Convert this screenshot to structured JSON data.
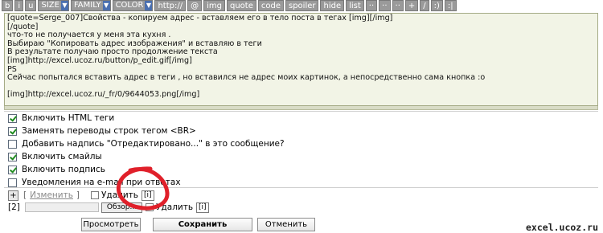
{
  "toolbar": {
    "buttons": [
      "b",
      "i",
      "u",
      "SIZE",
      "FAMILY",
      "COLOR",
      "http://",
      "@",
      "img",
      "quote",
      "code",
      "spoiler",
      "hide",
      "list",
      "··",
      "··",
      "··",
      "+",
      "/",
      ":)",
      ":|"
    ]
  },
  "editor": {
    "lines": [
      "[quote=Serge_007]Свойства - копируем адрес - вставляем его в тело поста в тегах [img][/img]",
      "[/quote]",
      "что-то не получается у меня эта кухня .",
      "Выбираю \"Копировать адрес изображения\" и вставляю в теги",
      "В результате получаю просто продолжение текста",
      "[img]http://excel.ucoz.ru/button/p_edit.gif[/img]",
      "PS",
      "Сейчас попытался вставить адрес в теги , но вставился не адрес моих картинок, а непосредственно сама кнопка :o",
      "",
      "[img]http://excel.ucoz.ru/_fr/0/9644053.png[/img]"
    ]
  },
  "options": [
    {
      "label": "Включить HTML теги",
      "checked": true
    },
    {
      "label": "Заменять переводы строк тегом <BR>",
      "checked": true
    },
    {
      "label": "Добавить надпись \"Отредактировано...\" в это сообщение?",
      "checked": false
    },
    {
      "label": "Включить смайлы",
      "checked": true
    },
    {
      "label": "Включить подпись",
      "checked": true
    },
    {
      "label": "Уведомления на e-mail при ответах",
      "checked": false
    }
  ],
  "attachments": {
    "row1": {
      "add": "+",
      "bracket_open": "[",
      "edit_label": "Изменить",
      "bracket_close": "]",
      "delete_label": "Удалить",
      "index_box": "[i]"
    },
    "row2": {
      "index": "[2]",
      "browse_label": "Обзор...",
      "delete_label": "Удалить",
      "index_box": "[i]"
    }
  },
  "buttons": {
    "preview": "Просмотреть",
    "save": "Сохранить",
    "cancel": "Отменить"
  },
  "watermark": "excel.ucoz.ru",
  "colors": {
    "toolbar_bg": "#9a9a9a",
    "editor_bg": "#f2f4e6",
    "annotation": "#e0202a"
  }
}
